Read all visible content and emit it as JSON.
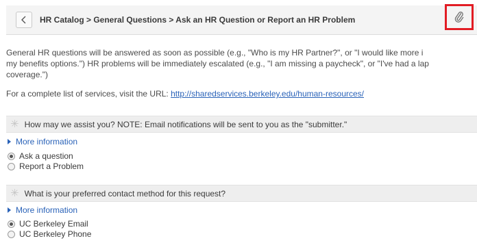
{
  "header": {
    "breadcrumb": "HR Catalog > General Questions > Ask an HR Question or Report an HR Problem"
  },
  "intro": {
    "line1": "General HR questions will be answered as soon as possible (e.g., \"Who is my HR Partner?\", or \"I would like more i",
    "line2": "my benefits options.\") HR problems will be immediately escalated (e.g., \"I am missing a paycheck\", or \"I've had a lap",
    "line3": "coverage.\")",
    "services_prefix": "For a complete list of services, visit the URL: ",
    "services_url": "http://sharedservices.berkeley.edu/human-resources/"
  },
  "questions": [
    {
      "required_mark": "✳",
      "label": "How may we assist you? NOTE: Email notifications will be sent to you as the \"submitter.\"",
      "more_info": "More information",
      "options": [
        "Ask a question",
        "Report a Problem"
      ],
      "selected": "Ask a question"
    },
    {
      "required_mark": "✳",
      "label": "What is your preferred contact method for this request?",
      "more_info": "More information",
      "options": [
        "UC Berkeley Email",
        "UC Berkeley Phone"
      ],
      "selected": "UC Berkeley Email"
    }
  ],
  "colors": {
    "accent_link": "#2962b8",
    "highlight_box": "#e21c24",
    "header_bg": "#f4f4f4"
  },
  "icons": {
    "back": "chevron-left-icon",
    "attachment": "paperclip-icon",
    "disclosure": "triangle-right-icon"
  }
}
